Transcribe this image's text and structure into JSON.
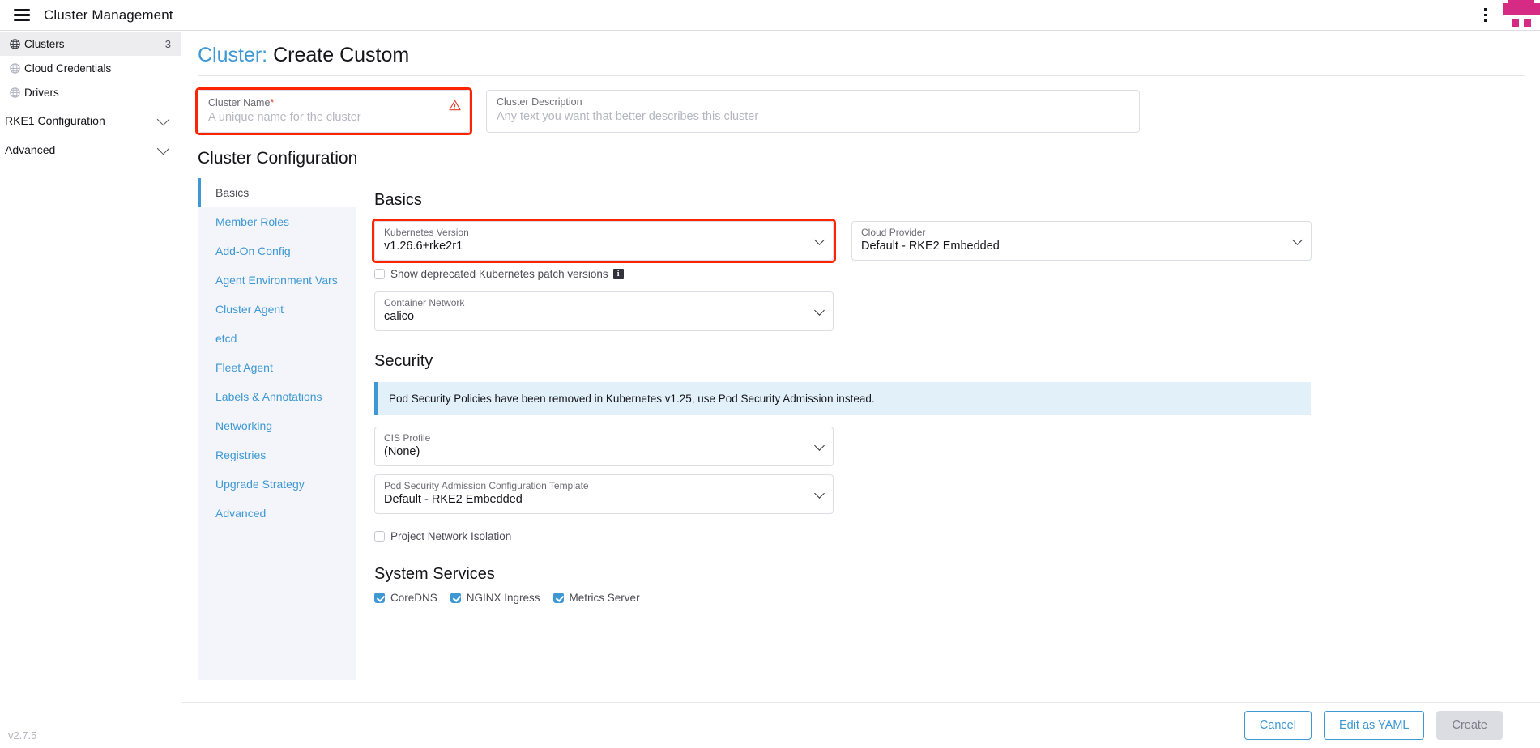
{
  "header": {
    "menu_icon": "hamburger-icon",
    "title": "Cluster Management",
    "kebab_icon": "vertical-dots-icon",
    "logo_icon": "rancher-logo",
    "accent_pink": "#d52b84"
  },
  "sidebar": {
    "items": [
      {
        "label": "Clusters",
        "icon": "globe-icon",
        "count": "3",
        "active": true
      },
      {
        "label": "Cloud Credentials",
        "icon": "globe-icon",
        "count": "",
        "active": false
      },
      {
        "label": "Drivers",
        "icon": "globe-icon",
        "count": "",
        "active": false
      }
    ],
    "groups": [
      {
        "label": "RKE1 Configuration",
        "icon": "chevron-down-icon"
      },
      {
        "label": "Advanced",
        "icon": "chevron-down-icon"
      }
    ],
    "version": "v2.7.5"
  },
  "page": {
    "title_prefix": "Cluster:",
    "title_main": "Create Custom"
  },
  "cluster_name": {
    "label": "Cluster Name",
    "required_marker": "*",
    "value": "",
    "placeholder": "A unique name for the cluster",
    "warning_icon": "warning-triangle-icon",
    "annotation_color": "#fc2500"
  },
  "cluster_description": {
    "label": "Cluster Description",
    "value": "",
    "placeholder": "Any text you want that better describes this cluster"
  },
  "config": {
    "heading": "Cluster Configuration",
    "tabs": [
      {
        "label": "Basics",
        "active": true
      },
      {
        "label": "Member Roles",
        "active": false
      },
      {
        "label": "Add-On Config",
        "active": false
      },
      {
        "label": "Agent Environment Vars",
        "active": false
      },
      {
        "label": "Cluster Agent",
        "active": false
      },
      {
        "label": "etcd",
        "active": false
      },
      {
        "label": "Fleet Agent",
        "active": false
      },
      {
        "label": "Labels & Annotations",
        "active": false
      },
      {
        "label": "Networking",
        "active": false
      },
      {
        "label": "Registries",
        "active": false
      },
      {
        "label": "Upgrade Strategy",
        "active": false
      },
      {
        "label": "Advanced",
        "active": false
      }
    ]
  },
  "basics": {
    "heading": "Basics",
    "kubernetes_version": {
      "label": "Kubernetes Version",
      "value": "v1.26.6+rke2r1",
      "icon": "chevron-down-icon",
      "annotated": true
    },
    "cloud_provider": {
      "label": "Cloud Provider",
      "value": "Default - RKE2 Embedded",
      "icon": "chevron-down-icon"
    },
    "show_deprecated": {
      "label": "Show deprecated Kubernetes patch versions",
      "checked": false,
      "info_icon": "info-icon"
    },
    "container_network": {
      "label": "Container Network",
      "value": "calico",
      "icon": "chevron-down-icon"
    }
  },
  "security": {
    "heading": "Security",
    "banner": "Pod Security Policies have been removed in Kubernetes v1.25, use Pod Security Admission instead.",
    "banner_accent": "#3d98d3",
    "cis_profile": {
      "label": "CIS Profile",
      "value": "(None)",
      "icon": "chevron-down-icon"
    },
    "psa_template": {
      "label": "Pod Security Admission Configuration Template",
      "value": "Default - RKE2 Embedded",
      "icon": "chevron-down-icon"
    },
    "project_network_isolation": {
      "label": "Project Network Isolation",
      "checked": false
    }
  },
  "system_services": {
    "heading": "System Services",
    "items": [
      {
        "label": "CoreDNS",
        "checked": true
      },
      {
        "label": "NGINX Ingress",
        "checked": true
      },
      {
        "label": "Metrics Server",
        "checked": true
      }
    ]
  },
  "footer": {
    "cancel_label": "Cancel",
    "yaml_label": "Edit as YAML",
    "create_label": "Create",
    "create_disabled": true,
    "accent_blue": "#3d98d3"
  }
}
